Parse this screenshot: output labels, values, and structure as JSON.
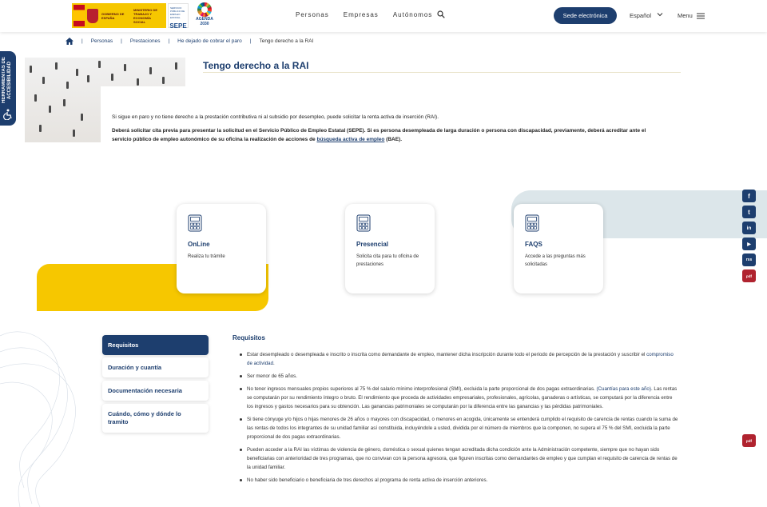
{
  "header": {
    "logo": {
      "gov_text": "GOBIERNO DE ESPAÑA",
      "ministry_text": "MINISTERIO DE TRABAJO Y ECONOMÍA SOCIAL",
      "sepe_small": "SERVICIO PÚBLICO DE EMPLEO ESTATAL",
      "sepe_big": "SEPE",
      "agenda_text": "AGENDA 2030"
    },
    "nav": [
      "Personas",
      "Empresas",
      "Autónomos"
    ],
    "sede_button": "Sede electrónica",
    "language": "Español",
    "menu_label": "Menu"
  },
  "breadcrumb": [
    "Personas",
    "Prestaciones",
    "He dejado de cobrar el paro",
    "Tengo derecho a la RAI"
  ],
  "accessibility_label": "HERRAMIENTAS DE ACCESIBILIDAD",
  "page": {
    "title": "Tengo derecho a la RAI",
    "intro1": "Si sigue en paro y no tiene derecho a la prestación contributiva ni al subsidio por desempleo, puede solicitar la renta activa de inserción (RAI).",
    "intro2_before": "Deberá solicitar cita previa para presentar la solicitud en el Servicio Público de Empleo Estatal (SEPE). Si es persona desempleada de larga duración o persona con discapacidad, previamente, deberá acreditar ante el servicio público de empleo autonómico de su oficina la realización de acciones de ",
    "intro2_link": "búsqueda activa de empleo",
    "intro2_after": " (BAE)."
  },
  "cards": [
    {
      "title": "OnLine",
      "desc": "Realiza tu trámite"
    },
    {
      "title": "Presencial",
      "desc": "Solicita cita para tu oficina de prestaciones"
    },
    {
      "title": "FAQS",
      "desc": "Accede a las preguntas más solicitadas"
    }
  ],
  "tabs": [
    "Requisitos",
    "Duración y cuantía",
    "Documentación necesaria",
    "Cuándo, cómo y dónde lo tramito"
  ],
  "requirements": {
    "title": "Requisitos",
    "items": [
      {
        "text": "Estar desempleado o desempleada e inscrito o inscrita como demandante de empleo, mantener dicha inscripción durante todo el periodo de percepción de la prestación y suscribir el ",
        "link": "compromiso de actividad",
        "after": "."
      },
      {
        "text": "Ser menor de 65 años.",
        "link": "",
        "after": ""
      },
      {
        "text": "No tener ingresos mensuales propios superiores al 75 % del salario mínimo interprofesional (SMI), excluida la parte proporcional de dos pagas extraordinarias. ",
        "link": "(Cuantías para este año)",
        "after": ". Las rentas se computarán por su rendimiento íntegro o bruto. El rendimiento que proceda de actividades empresariales, profesionales, agrícolas, ganaderas o artísticas, se computará por la diferencia entre los ingresos y gastos necesarios para su obtención. Las ganancias patrimoniales se computarán por la diferencia entre las ganancias y las pérdidas patrimoniales."
      },
      {
        "text": "Si tiene cónyuge y/o hijos o hijas menores de 26 años o mayores con discapacidad, o menores en acogida, únicamente se entenderá cumplido el requisito de carencia de rentas cuando la suma de las rentas de todos los integrantes de su unidad familiar así constituida, incluyéndole a usted, dividida por el número de miembros que la componen, no supera el 75 % del SMI, excluida la parte proporcional de dos pagas extraordinarias.",
        "link": "",
        "after": ""
      },
      {
        "text": "Pueden acceder a la RAI las víctimas de violencia de género, doméstica o sexual quienes tengan acreditada dicha condición ante la Administración competente, siempre que no hayan sido beneficiarias con anterioridad de tres programas, que no convivan con la persona agresora, que figuren inscritas como demandantes de empleo y que cumplan el requisito de carencia de rentas de la unidad familiar.",
        "link": "",
        "after": ""
      },
      {
        "text": "No haber sido beneficiario o beneficiaria de tres derechos al programa de renta activa de inserción anteriores.",
        "link": "",
        "after": ""
      }
    ]
  },
  "social": [
    "f",
    "t",
    "in",
    "▶",
    "rss",
    "pdf"
  ],
  "colors": {
    "primary": "#1d3e6e",
    "accent_yellow": "#f6c700",
    "light_blue": "#dce6ea",
    "pdf_red": "#b0232f"
  }
}
